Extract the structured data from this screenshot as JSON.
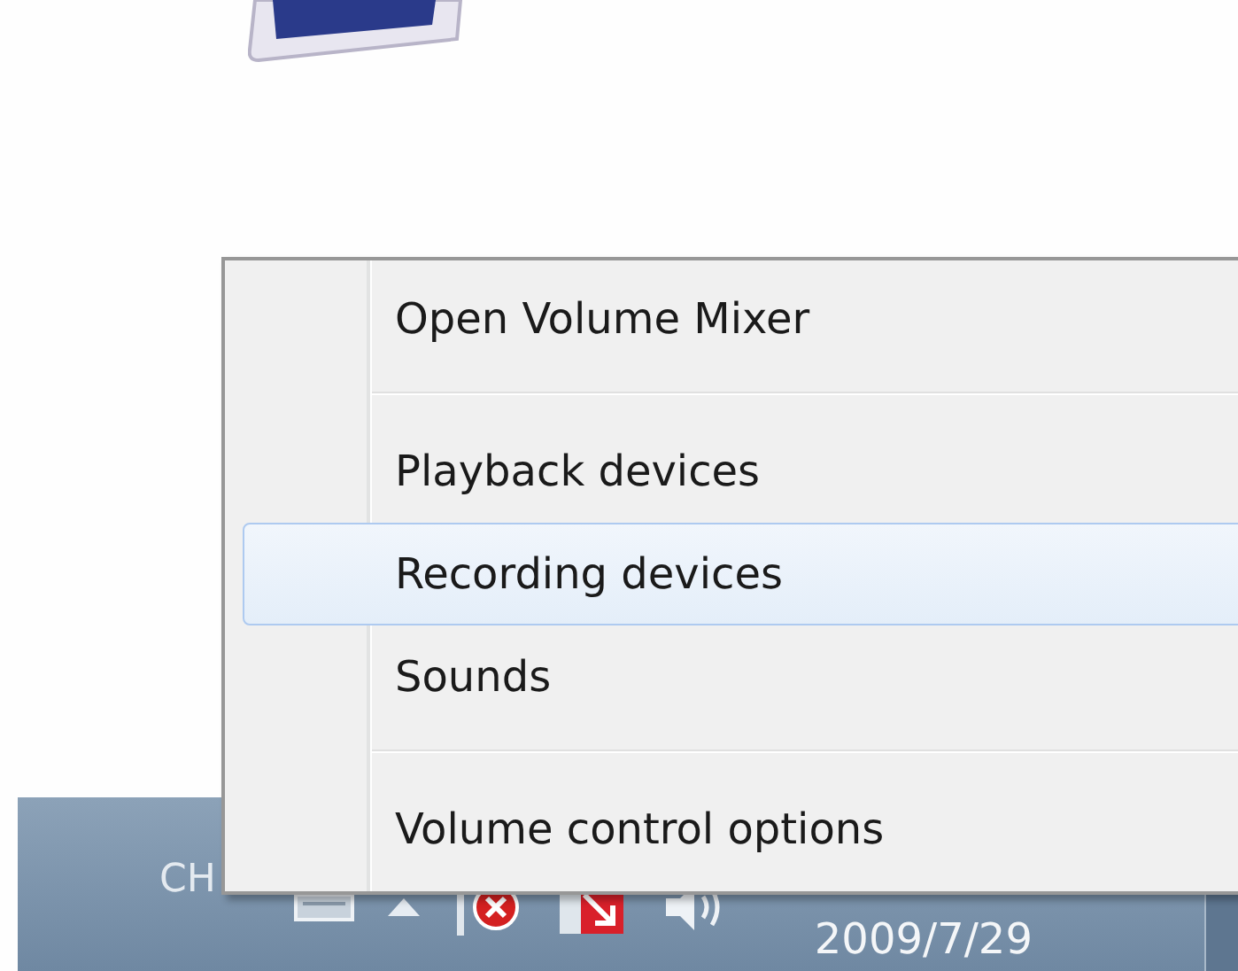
{
  "menu": {
    "items": [
      {
        "kind": "item",
        "label": "Open Volume Mixer",
        "selected": false
      },
      {
        "kind": "separator"
      },
      {
        "kind": "item",
        "label": "Playback devices",
        "selected": false
      },
      {
        "kind": "item",
        "label": "Recording devices",
        "selected": true
      },
      {
        "kind": "item",
        "label": "Sounds",
        "selected": false
      },
      {
        "kind": "separator"
      },
      {
        "kind": "item",
        "label": "Volume control options",
        "selected": false
      }
    ]
  },
  "taskbar": {
    "language": "CH",
    "date": "2009/7/29"
  }
}
